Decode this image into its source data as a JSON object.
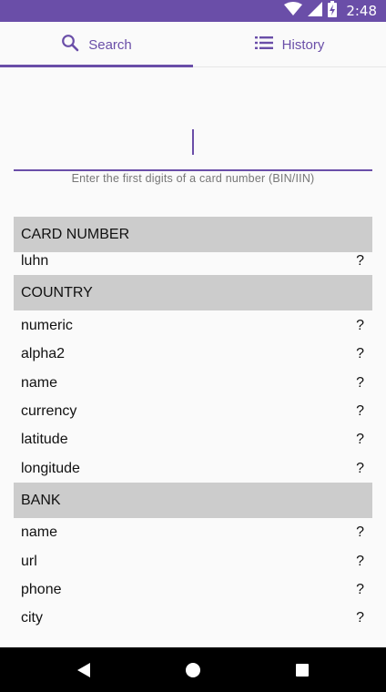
{
  "status_bar": {
    "time": "2:48",
    "icons": [
      "wifi-icon",
      "signal-icon",
      "battery-charging-icon"
    ]
  },
  "tabs": [
    {
      "label": "Search",
      "icon": "search-icon",
      "selected": true
    },
    {
      "label": "History",
      "icon": "list-icon",
      "selected": false
    }
  ],
  "search": {
    "value": "",
    "hint": "Enter the first digits of a card number (BIN/IIN)"
  },
  "sections": {
    "card_number": {
      "title": "CARD NUMBER",
      "rows": [
        {
          "label": "luhn",
          "value": "?"
        }
      ]
    },
    "country": {
      "title": "COUNTRY",
      "rows": [
        {
          "label": "numeric",
          "value": "?"
        },
        {
          "label": "alpha2",
          "value": "?"
        },
        {
          "label": "name",
          "value": "?"
        },
        {
          "label": "currency",
          "value": "?"
        },
        {
          "label": "latitude",
          "value": "?"
        },
        {
          "label": "longitude",
          "value": "?"
        }
      ]
    },
    "bank": {
      "title": "BANK",
      "rows": [
        {
          "label": "name",
          "value": "?"
        },
        {
          "label": "url",
          "value": "?"
        },
        {
          "label": "phone",
          "value": "?"
        },
        {
          "label": "city",
          "value": "?"
        }
      ]
    }
  },
  "colors": {
    "accent": "#6a4ea8",
    "section_header_bg": "#cccccc",
    "background": "#fafafa"
  },
  "nav_bar": {
    "buttons": [
      "back-icon",
      "home-icon",
      "recents-icon"
    ]
  }
}
